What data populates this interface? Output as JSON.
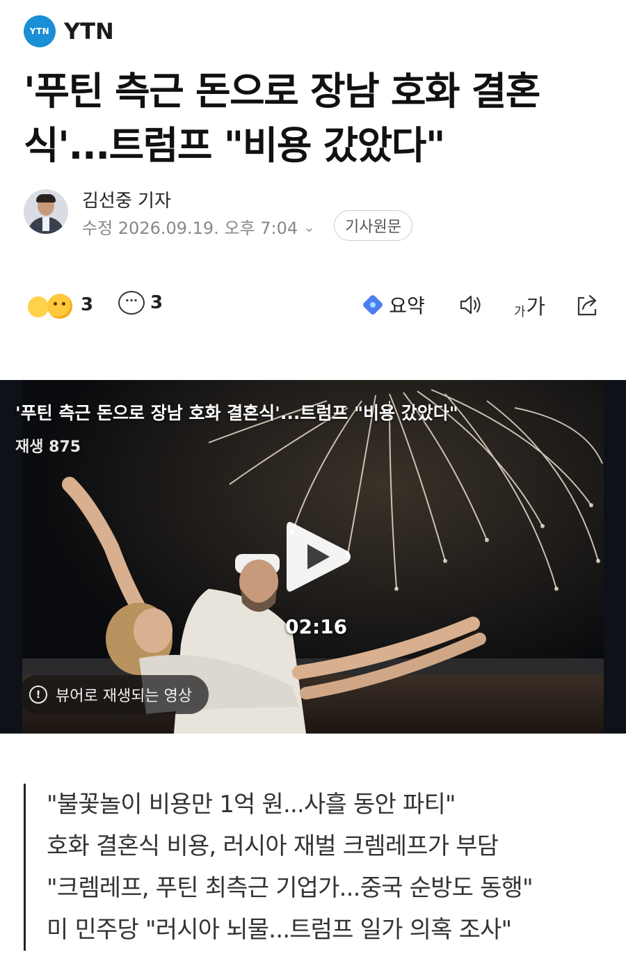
{
  "press": {
    "logo_text": "YTN",
    "name": "YTN",
    "brand_color": "#1a8fd6"
  },
  "article": {
    "title": "'푸틴 측근 돈으로 장남 호화 결혼식'...트럼프 \"비용 갔았다\"",
    "reporter": "김선중 기자",
    "meta": "수정 2026.09.19. 오후 7:04",
    "original_button": "기사원문"
  },
  "toolbar": {
    "reaction_icon": "reaction-emoji-icon",
    "reaction_count": "3",
    "comment_icon": "comment-icon",
    "comment_count": "3",
    "summary_label": "요약",
    "font_small": "가",
    "font_big": "가",
    "icons": [
      "summary-sparkle-icon",
      "speaker-icon",
      "font-size-icon",
      "share-icon"
    ]
  },
  "video": {
    "title": "'푸틴 측근 돈으로 장남 호화 결혼식'...트럼프 \"비용 갔았다\"",
    "plays": "재생 875",
    "duration": "02:16",
    "notice": "뷰어로 재생되는 영상",
    "notice_icon": "!"
  },
  "summary": [
    "\"불꽃놀이 비용만 1억 원...사흘 동안 파티\"",
    "호화 결혼식 비용, 러시아 재벌 크렘레프가 부담",
    "\"크렘레프, 푸틴 최측근 기업가...중국 순방도 동행\"",
    "미 민주당 \"러시아 뇌물...트럼프 일가 의혹 조사\""
  ]
}
